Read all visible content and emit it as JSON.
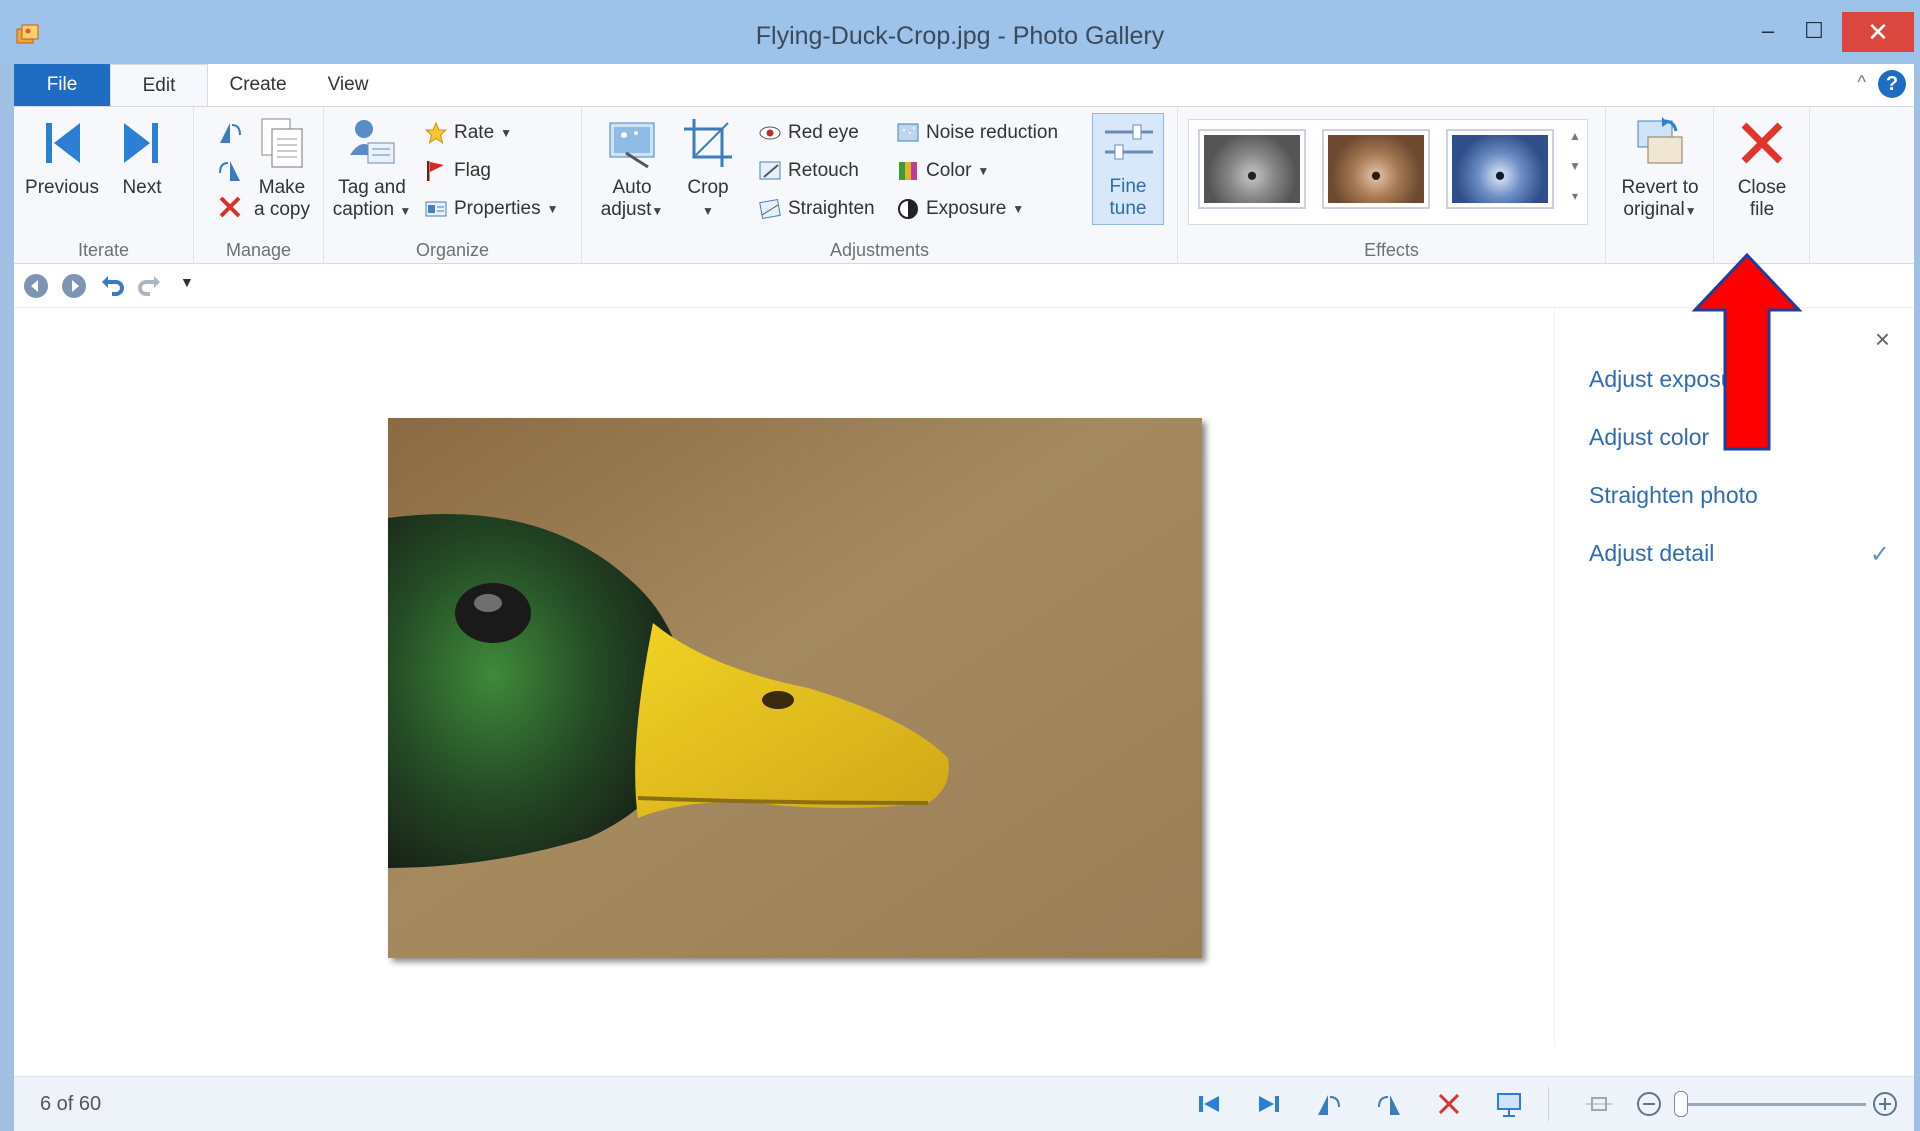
{
  "window": {
    "title": "Flying-Duck-Crop.jpg - Photo Gallery",
    "minimize": "–",
    "maximize": "☐",
    "close": "✕"
  },
  "tabs": [
    {
      "label": "File"
    },
    {
      "label": "Edit"
    },
    {
      "label": "Create"
    },
    {
      "label": "View"
    }
  ],
  "ribbon": {
    "iterate": {
      "label": "Iterate",
      "previous": "Previous",
      "next": "Next"
    },
    "manage": {
      "label": "Manage",
      "make_copy_1": "Make",
      "make_copy_2": "a copy"
    },
    "organize": {
      "label": "Organize",
      "tag_1": "Tag and",
      "tag_2": "caption",
      "rate": "Rate",
      "flag": "Flag",
      "properties": "Properties"
    },
    "adjustments": {
      "label": "Adjustments",
      "auto_1": "Auto",
      "auto_2": "adjust",
      "crop": "Crop",
      "red_eye": "Red eye",
      "retouch": "Retouch",
      "straighten": "Straighten",
      "noise_reduction": "Noise reduction",
      "color": "Color",
      "exposure": "Exposure",
      "fine_1": "Fine",
      "fine_2": "tune"
    },
    "effects": {
      "label": "Effects"
    },
    "revert_1": "Revert to",
    "revert_2": "original",
    "close_1": "Close",
    "close_2": "file"
  },
  "panel": {
    "items": [
      {
        "label": "Adjust exposu"
      },
      {
        "label": "Adjust color"
      },
      {
        "label": "Straighten photo"
      },
      {
        "label": "Adjust detail"
      }
    ],
    "check": "✓",
    "close": "×"
  },
  "status": {
    "count": "6 of 60"
  },
  "colors": {
    "accent": "#1f6cc3",
    "title_bar": "#9ec3ea",
    "close_button": "#d9473e",
    "arrow_fill": "#ff0000",
    "arrow_outline": "#1b3f9c"
  }
}
